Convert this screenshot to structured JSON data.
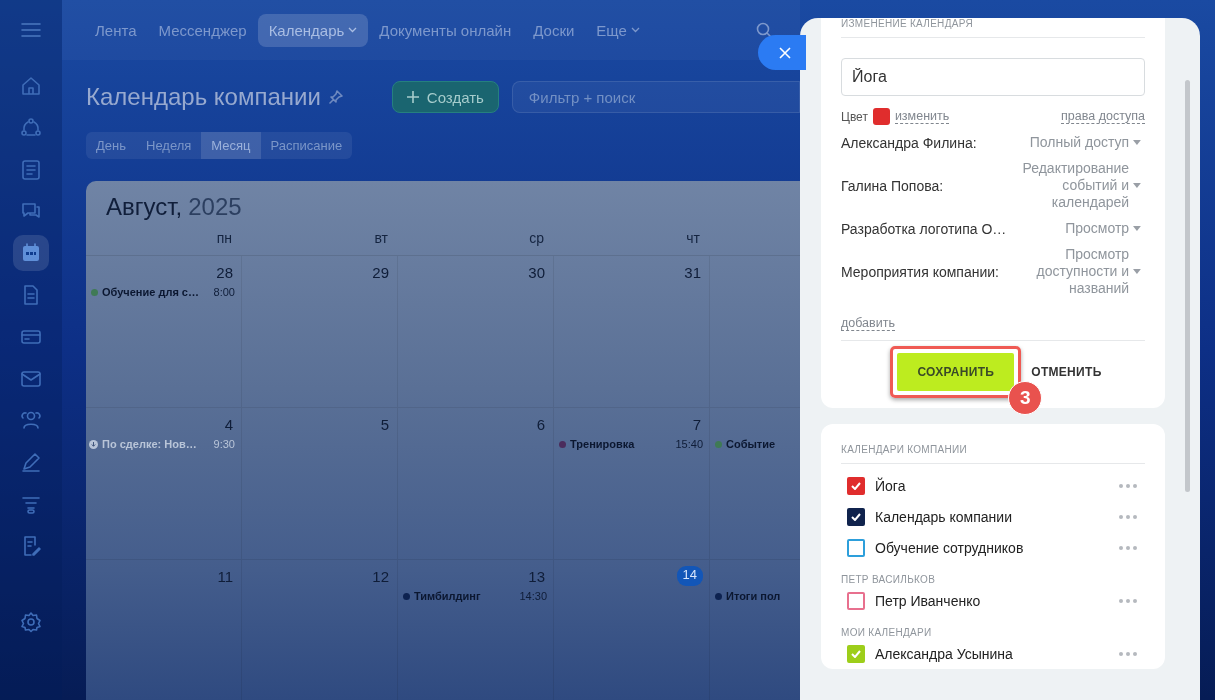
{
  "sidebar": {
    "items": [
      {
        "selected": false
      },
      {
        "selected": false
      },
      {
        "selected": false
      },
      {
        "selected": false
      },
      {
        "selected": true
      },
      {
        "selected": false
      },
      {
        "selected": false
      },
      {
        "selected": false
      },
      {
        "selected": false
      },
      {
        "selected": false
      },
      {
        "selected": false
      },
      {
        "selected": false
      },
      {
        "selected": false
      }
    ]
  },
  "top_nav": {
    "items": [
      {
        "label": "Лента",
        "selected": false,
        "dropdown": false
      },
      {
        "label": "Мессенджер",
        "selected": false,
        "dropdown": false
      },
      {
        "label": "Календарь",
        "selected": true,
        "dropdown": true
      },
      {
        "label": "Документы онлайн",
        "selected": false,
        "dropdown": false
      },
      {
        "label": "Доски",
        "selected": false,
        "dropdown": false
      },
      {
        "label": "Еще",
        "selected": false,
        "dropdown": true
      }
    ]
  },
  "page": {
    "title": "Календарь компании",
    "create_button": "Создать",
    "filter": {
      "placeholder": "Фильтр + поиск"
    },
    "views": [
      {
        "label": "День",
        "selected": false
      },
      {
        "label": "Неделя",
        "selected": false
      },
      {
        "label": "Месяц",
        "selected": true
      },
      {
        "label": "Расписание",
        "selected": false
      }
    ]
  },
  "calendar": {
    "month": "Август,",
    "year": "2025",
    "weekdays": [
      "пн",
      "вт",
      "ср",
      "чт"
    ],
    "weeks": [
      [
        {
          "day": "28",
          "today": false,
          "events": [
            {
              "kind": "event",
              "title": "Обучение для с…",
              "time": "8:00",
              "color": "#3f7a55"
            }
          ]
        },
        {
          "day": "29",
          "today": false
        },
        {
          "day": "30",
          "today": false
        },
        {
          "day": "31",
          "today": false
        }
      ],
      [
        {
          "day": "4",
          "today": false,
          "events": [
            {
              "kind": "deal",
              "title": "По сделке: Нов…",
              "time": "9:30"
            }
          ]
        },
        {
          "day": "5",
          "today": false
        },
        {
          "day": "6",
          "today": false
        },
        {
          "day": "7",
          "today": false,
          "events": [
            {
              "kind": "event",
              "title": "Тренировка",
              "time": "15:40",
              "color": "#4b2c5c"
            }
          ]
        },
        {
          "events": [
            {
              "kind": "event",
              "title": "Событие",
              "color": "#3f7a55"
            }
          ]
        }
      ],
      [
        {
          "day": "11",
          "today": false
        },
        {
          "day": "12",
          "today": false
        },
        {
          "day": "13",
          "today": false,
          "events": [
            {
              "kind": "event",
              "title": "Тимбилдинг",
              "time": "14:30",
              "color": "#0d2250"
            }
          ]
        },
        {
          "day": "14",
          "today": true
        },
        {
          "events": [
            {
              "kind": "event",
              "title": "Итоги пол",
              "color": "#0d2250"
            }
          ]
        }
      ]
    ]
  },
  "panel": {
    "heading": "ИЗМЕНЕНИЕ КАЛЕНДАРЯ",
    "name_value": "Йога",
    "color_label": "Цвет",
    "color": "#e02d2d",
    "change_link": "изменить",
    "access_link": "права доступа",
    "access": [
      {
        "name": "Александра Филина:",
        "level": "Полный доступ"
      },
      {
        "name": "Галина Попова:",
        "level": "Редактирование событий и календарей"
      },
      {
        "name": "Разработка логотипа О…",
        "level": "Просмотр"
      },
      {
        "name": "Мероприятия компании:",
        "level": "Просмотр доступности и названий"
      }
    ],
    "add_link": "добавить",
    "save_button": {
      "label": "СОХРАНИТЬ",
      "highlighted": true,
      "badge": "3"
    },
    "cancel_button": "ОТМЕНИТЬ",
    "calendars": [
      {
        "heading": "КАЛЕНДАРИ КОМПАНИИ",
        "items": [
          {
            "name": "Йога",
            "color": "#e02d2d",
            "checked": true
          },
          {
            "name": "Календарь компании",
            "color": "#10234d",
            "checked": true
          },
          {
            "name": "Обучение сотрудников",
            "color": "#2d9fdb",
            "checked": false
          }
        ]
      },
      {
        "heading": "ПЕТР ВАСИЛЬКОВ",
        "items": [
          {
            "name": "Петр Иванченко",
            "color": "#e8708e",
            "checked": false
          }
        ]
      },
      {
        "heading": "МОИ КАЛЕНДАРИ",
        "items": [
          {
            "name": "Александра Усынина",
            "color": "#9dce1a",
            "checked": true
          }
        ]
      }
    ]
  }
}
